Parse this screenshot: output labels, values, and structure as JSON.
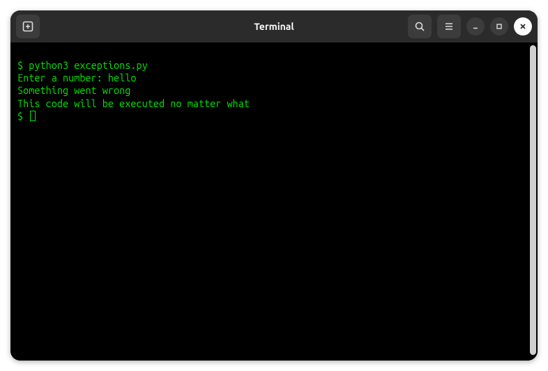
{
  "titlebar": {
    "title": "Terminal"
  },
  "terminal": {
    "prompt": "$",
    "lines": {
      "l1_cmd": "python3 exceptions.py",
      "l2": "Enter a number: hello",
      "l3": "Something went wrong",
      "l4": "This code will be executed no matter what"
    }
  }
}
